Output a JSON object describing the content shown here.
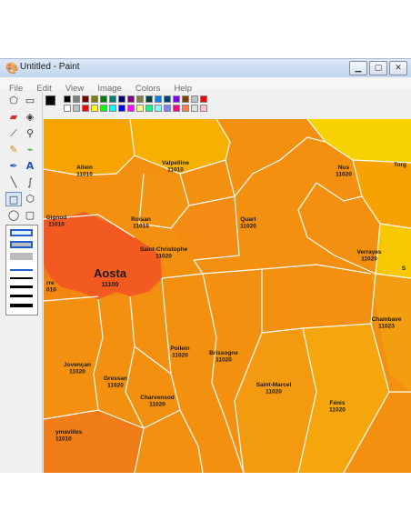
{
  "window": {
    "title": "Untitled - Paint",
    "app_icon": "paint-icon"
  },
  "window_buttons": [
    "minimize-icon",
    "maximize-icon",
    "close-icon"
  ],
  "menu": [
    "File",
    "Edit",
    "View",
    "Image",
    "Colors",
    "Help"
  ],
  "tools": [
    "free-select-icon",
    "select-icon",
    "eraser-icon",
    "fill-icon",
    "color-picker-icon",
    "magnifier-icon",
    "pencil-icon",
    "brush-icon",
    "airbrush-icon",
    "text-icon",
    "line-icon",
    "curve-icon",
    "rectangle-icon",
    "polygon-icon",
    "ellipse-icon",
    "rounded-rectangle-icon"
  ],
  "colors": {
    "primary": "#000000",
    "secondary": "#ffffff",
    "palette_row1": [
      "#000000",
      "#808080",
      "#800000",
      "#808000",
      "#008000",
      "#008080",
      "#000080",
      "#800080",
      "#808040",
      "#004040",
      "#0080ff",
      "#004080",
      "#8000ff",
      "#804000",
      "#c0c0c0",
      "#ff0000"
    ],
    "palette_row2": [
      "#ffffff",
      "#c0c0c0",
      "#ff0000",
      "#ffff00",
      "#00ff00",
      "#00ffff",
      "#0000ff",
      "#ff00ff",
      "#ffff80",
      "#00ff80",
      "#80ffff",
      "#8080ff",
      "#ff0080",
      "#ff8040",
      "#e0e0e0",
      "#ffc0c0"
    ],
    "map_yellow": "#f7d200",
    "map_light_orange": "#f7a600",
    "map_orange": "#f38e12",
    "map_dark_orange": "#f07b18",
    "map_red": "#f25a22"
  },
  "map": {
    "labels": [
      {
        "name": "Allein",
        "code": "11010"
      },
      {
        "name": "Valpelline",
        "code": "11010"
      },
      {
        "name": "Nus",
        "code": "11020"
      },
      {
        "name": "Torg",
        "code": ""
      },
      {
        "name": "Gignod",
        "code": "11010"
      },
      {
        "name": "Roisan",
        "code": "11010"
      },
      {
        "name": "Quart",
        "code": "11020"
      },
      {
        "name": "Saint-Christophe",
        "code": "11020"
      },
      {
        "name": "Verrayes",
        "code": "11020"
      },
      {
        "name": "S",
        "code": ""
      },
      {
        "name": "Aosta",
        "code": "11100"
      },
      {
        "name": "rre",
        "code": "010"
      },
      {
        "name": "Chambave",
        "code": "11023"
      },
      {
        "name": "Pollein",
        "code": "11020"
      },
      {
        "name": "Brissogne",
        "code": "11020"
      },
      {
        "name": "Jovençan",
        "code": "11020"
      },
      {
        "name": "Gressan",
        "code": "11020"
      },
      {
        "name": "Saint-Marcel",
        "code": "11020"
      },
      {
        "name": "Charvensod",
        "code": "11020"
      },
      {
        "name": "Fénis",
        "code": "11020"
      },
      {
        "name": "ymavilles",
        "code": "11010"
      }
    ]
  }
}
